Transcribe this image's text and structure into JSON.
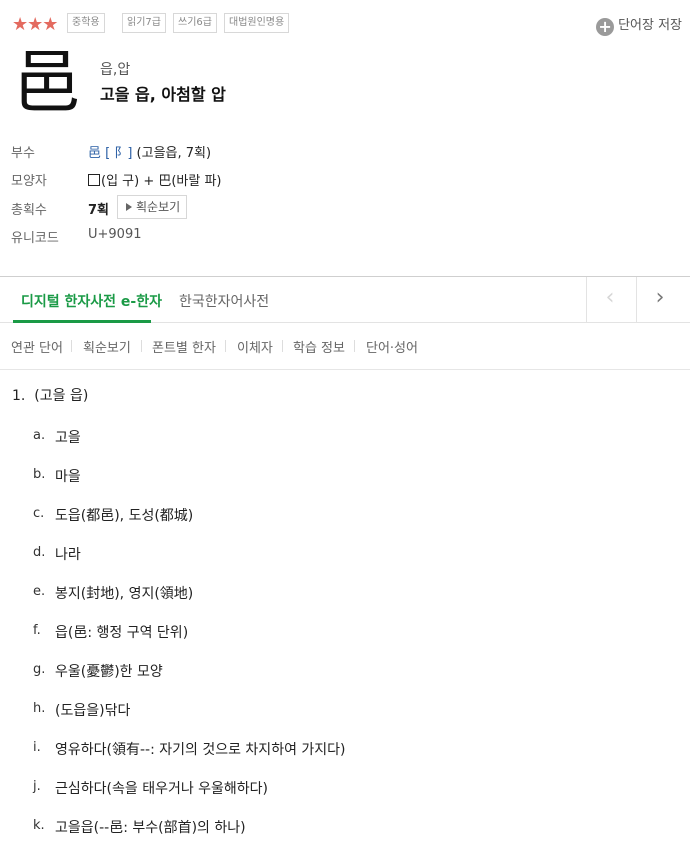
{
  "header": {
    "stars": "★★★",
    "tags": [
      "중학용",
      "읽기7급",
      "쓰기6급",
      "대법원인명용"
    ],
    "save_label": "단어장 저장",
    "save_icon": "plus-circle-icon"
  },
  "hanja": {
    "char": "邑",
    "reading": "읍,압",
    "meaning": "고을 읍, 아첨할 압"
  },
  "info": {
    "radical_label": "부수",
    "radical_link": "邑 [ 阝]",
    "radical_text": " (고을읍, 7획)",
    "shape_label": "모양자",
    "shape_text": "(입 구) + 巴(바랄 파)",
    "strokes_label": "총획수",
    "strokes_value": "7획",
    "stroke_button": "획순보기",
    "unicode_label": "유니코드",
    "unicode_value": "U+9091"
  },
  "tabs": {
    "active": "디지털 한자사전 e-한자",
    "other": "한국한자어사전",
    "prev_icon": "chevron-left-icon",
    "next_icon": "chevron-right-icon"
  },
  "subnav": [
    "연관 단어",
    "획순보기",
    "폰트별 한자",
    "이체자",
    "학습 정보",
    "단어·성어"
  ],
  "definitions": {
    "main_number": "1.",
    "main_text": "(고을 읍)",
    "items": [
      {
        "letter": "a.",
        "text": "고을"
      },
      {
        "letter": "b.",
        "text": "마을"
      },
      {
        "letter": "c.",
        "text": "도읍(都邑), 도성(都城)"
      },
      {
        "letter": "d.",
        "text": "나라"
      },
      {
        "letter": "e.",
        "text": "봉지(封地), 영지(領地)"
      },
      {
        "letter": "f.",
        "text": "읍(邑: 행정 구역 단위)"
      },
      {
        "letter": "g.",
        "text": "우울(憂鬱)한 모양"
      },
      {
        "letter": "h.",
        "text": "(도읍을)닦다"
      },
      {
        "letter": "i.",
        "text": "영유하다(領有--: 자기의 것으로 차지하여 가지다)"
      },
      {
        "letter": "j.",
        "text": "근심하다(속을 태우거나 우울해하다)"
      },
      {
        "letter": "k.",
        "text": "고을읍(--邑: 부수(部首)의 하나)"
      }
    ]
  }
}
